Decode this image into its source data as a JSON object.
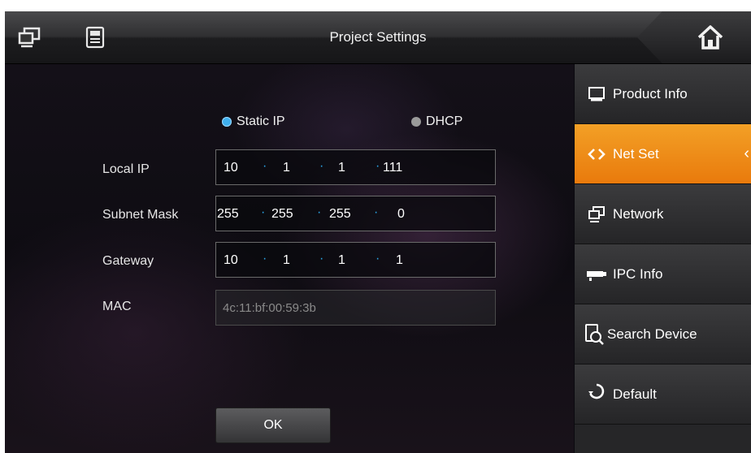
{
  "header": {
    "title": "Project Settings",
    "left_icons": [
      "monitor-icon",
      "device-panel-icon"
    ],
    "home_icon": "home-icon"
  },
  "network_mode": {
    "options": [
      {
        "label": "Static IP",
        "selected": true
      },
      {
        "label": "DHCP",
        "selected": false
      }
    ]
  },
  "form": {
    "local_ip": {
      "label": "Local IP",
      "octets": [
        "10",
        "1",
        "1",
        "111"
      ]
    },
    "subnet_mask": {
      "label": "Subnet Mask",
      "octets": [
        "255",
        "255",
        "255",
        "0"
      ]
    },
    "gateway": {
      "label": "Gateway",
      "octets": [
        "10",
        "1",
        "1",
        "1"
      ]
    },
    "mac": {
      "label": "MAC",
      "value": "4c:11:bf:00:59:3b"
    },
    "ok_label": "OK"
  },
  "sidebar": {
    "items": [
      {
        "label": "Product Info",
        "icon": "monitor-icon",
        "active": false
      },
      {
        "label": "Net Set",
        "icon": "code-brackets-icon",
        "active": true
      },
      {
        "label": "Network",
        "icon": "network-icon",
        "active": false
      },
      {
        "label": "IPC Info",
        "icon": "camera-icon",
        "active": false
      },
      {
        "label": "Search Device",
        "icon": "search-device-icon",
        "active": false
      },
      {
        "label": "Default",
        "icon": "recycle-icon",
        "active": false
      }
    ]
  },
  "colors": {
    "accent_active": "#f08a18",
    "radio_selected": "#3fb0ee",
    "ip_separator": "#2aa6e8"
  }
}
